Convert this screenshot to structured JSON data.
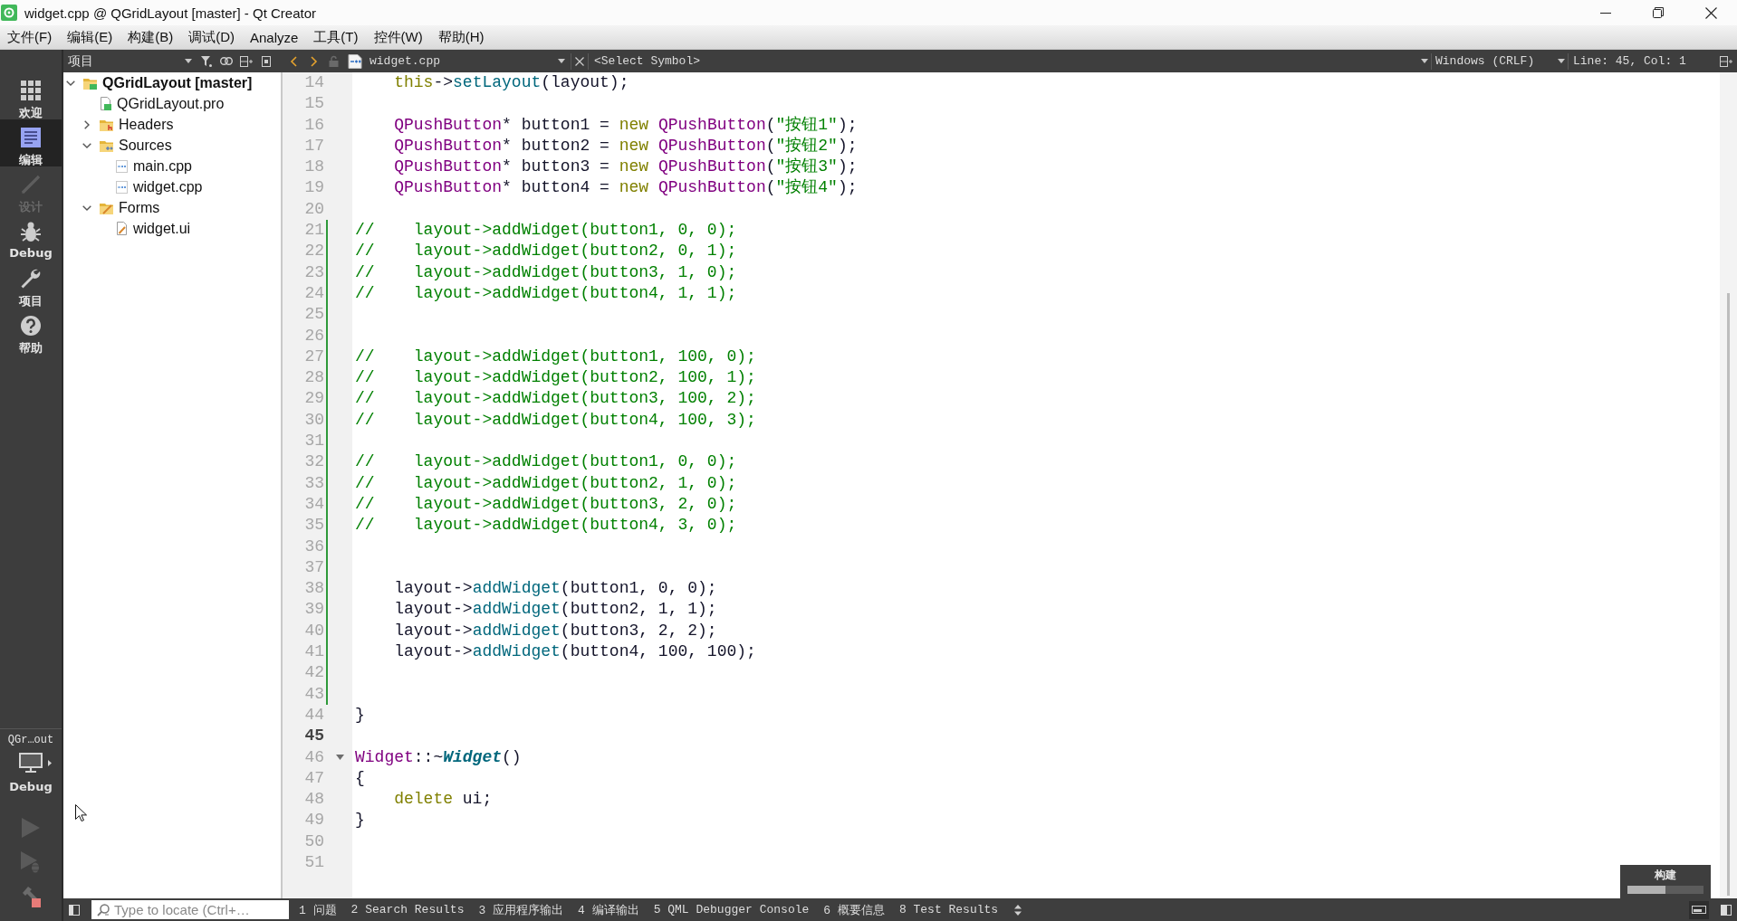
{
  "window": {
    "title": "widget.cpp @ QGridLayout [master] - Qt Creator"
  },
  "menu": [
    "文件(F)",
    "编辑(E)",
    "构建(B)",
    "调试(D)",
    "Analyze",
    "工具(T)",
    "控件(W)",
    "帮助(H)"
  ],
  "modes": [
    {
      "label": "欢迎",
      "kind": "welcome",
      "selected": false,
      "disabled": false
    },
    {
      "label": "编辑",
      "kind": "edit",
      "selected": true,
      "disabled": false
    },
    {
      "label": "设计",
      "kind": "design",
      "selected": false,
      "disabled": true
    },
    {
      "label": "Debug",
      "kind": "debug",
      "selected": false,
      "disabled": false
    },
    {
      "label": "项目",
      "kind": "projects",
      "selected": false,
      "disabled": false
    },
    {
      "label": "帮助",
      "kind": "help",
      "selected": false,
      "disabled": false
    }
  ],
  "kit": {
    "project": "QGr…out",
    "config": "Debug"
  },
  "run_buttons": [
    {
      "kind": "run",
      "disabled": true
    },
    {
      "kind": "debug",
      "disabled": true
    },
    {
      "kind": "stop-build",
      "disabled": false
    }
  ],
  "project_pane": {
    "view": "项目",
    "tree": [
      {
        "label": "QGridLayout [master]",
        "kind": "project",
        "expanded": true,
        "children": [
          {
            "label": "QGridLayout.pro",
            "kind": "pro-file"
          },
          {
            "label": "Headers",
            "kind": "header-folder",
            "expanded": false
          },
          {
            "label": "Sources",
            "kind": "source-folder",
            "expanded": true,
            "children": [
              {
                "label": "main.cpp",
                "kind": "cpp-file"
              },
              {
                "label": "widget.cpp",
                "kind": "cpp-file"
              }
            ]
          },
          {
            "label": "Forms",
            "kind": "form-folder",
            "expanded": true,
            "children": [
              {
                "label": "widget.ui",
                "kind": "ui-file"
              }
            ]
          }
        ]
      }
    ]
  },
  "editor": {
    "file": "widget.cpp",
    "symbol": "<Select Symbol>",
    "line_ending": "Windows (CRLF)",
    "cursor": "Line: 45, Col: 1",
    "lines": [
      {
        "number": "14",
        "indented": true,
        "tokens": [
          {
            "kind": "keyword",
            "text": "this"
          },
          {
            "kind": "plain",
            "text": "->"
          },
          {
            "kind": "function",
            "text": "setLayout"
          },
          {
            "kind": "plain",
            "text": "(layout);"
          }
        ],
        "changed": false,
        "current": false,
        "fold": false
      },
      {
        "number": "15",
        "changed": false,
        "current": false,
        "fold": false
      },
      {
        "number": "16",
        "indented": true,
        "tokens": [
          {
            "kind": "type",
            "text": "QPushButton"
          },
          {
            "kind": "plain",
            "text": "* button1 = "
          },
          {
            "kind": "keyword",
            "text": "new "
          },
          {
            "kind": "type",
            "text": "QPushButton"
          },
          {
            "kind": "plain",
            "text": "("
          },
          {
            "kind": "string",
            "text": "\"按钮1\""
          },
          {
            "kind": "plain",
            "text": ");"
          }
        ],
        "changed": false,
        "current": false,
        "fold": false
      },
      {
        "number": "17",
        "indented": true,
        "tokens": [
          {
            "kind": "type",
            "text": "QPushButton"
          },
          {
            "kind": "plain",
            "text": "* button2 = "
          },
          {
            "kind": "keyword",
            "text": "new "
          },
          {
            "kind": "type",
            "text": "QPushButton"
          },
          {
            "kind": "plain",
            "text": "("
          },
          {
            "kind": "string",
            "text": "\"按钮2\""
          },
          {
            "kind": "plain",
            "text": ");"
          }
        ],
        "changed": false,
        "current": false,
        "fold": false
      },
      {
        "number": "18",
        "indented": true,
        "tokens": [
          {
            "kind": "type",
            "text": "QPushButton"
          },
          {
            "kind": "plain",
            "text": "* button3 = "
          },
          {
            "kind": "keyword",
            "text": "new "
          },
          {
            "kind": "type",
            "text": "QPushButton"
          },
          {
            "kind": "plain",
            "text": "("
          },
          {
            "kind": "string",
            "text": "\"按钮3\""
          },
          {
            "kind": "plain",
            "text": ");"
          }
        ],
        "changed": false,
        "current": false,
        "fold": false
      },
      {
        "number": "19",
        "indented": true,
        "tokens": [
          {
            "kind": "type",
            "text": "QPushButton"
          },
          {
            "kind": "plain",
            "text": "* button4 = "
          },
          {
            "kind": "keyword",
            "text": "new "
          },
          {
            "kind": "type",
            "text": "QPushButton"
          },
          {
            "kind": "plain",
            "text": "("
          },
          {
            "kind": "string",
            "text": "\"按钮4\""
          },
          {
            "kind": "plain",
            "text": ");"
          }
        ],
        "changed": false,
        "current": false,
        "fold": false
      },
      {
        "number": "20",
        "changed": false,
        "current": false,
        "fold": false
      },
      {
        "number": "21",
        "indented": false,
        "tokens": [
          {
            "kind": "comment",
            "text": "//    layout->addWidget(button1, 0, 0);"
          }
        ],
        "changed": true,
        "current": false,
        "fold": false
      },
      {
        "number": "22",
        "indented": false,
        "tokens": [
          {
            "kind": "comment",
            "text": "//    layout->addWidget(button2, 0, 1);"
          }
        ],
        "changed": true,
        "current": false,
        "fold": false
      },
      {
        "number": "23",
        "indented": false,
        "tokens": [
          {
            "kind": "comment",
            "text": "//    layout->addWidget(button3, 1, 0);"
          }
        ],
        "changed": true,
        "current": false,
        "fold": false
      },
      {
        "number": "24",
        "indented": false,
        "tokens": [
          {
            "kind": "comment",
            "text": "//    layout->addWidget(button4, 1, 1);"
          }
        ],
        "changed": true,
        "current": false,
        "fold": false
      },
      {
        "number": "25",
        "changed": true,
        "current": false,
        "fold": false
      },
      {
        "number": "26",
        "changed": true,
        "current": false,
        "fold": false
      },
      {
        "number": "27",
        "indented": false,
        "tokens": [
          {
            "kind": "comment",
            "text": "//    layout->addWidget(button1, 100, 0);"
          }
        ],
        "changed": true,
        "current": false,
        "fold": false
      },
      {
        "number": "28",
        "indented": false,
        "tokens": [
          {
            "kind": "comment",
            "text": "//    layout->addWidget(button2, 100, 1);"
          }
        ],
        "changed": true,
        "current": false,
        "fold": false
      },
      {
        "number": "29",
        "indented": false,
        "tokens": [
          {
            "kind": "comment",
            "text": "//    layout->addWidget(button3, 100, 2);"
          }
        ],
        "changed": true,
        "current": false,
        "fold": false
      },
      {
        "number": "30",
        "indented": false,
        "tokens": [
          {
            "kind": "comment",
            "text": "//    layout->addWidget(button4, 100, 3);"
          }
        ],
        "changed": true,
        "current": false,
        "fold": false
      },
      {
        "number": "31",
        "changed": true,
        "current": false,
        "fold": false
      },
      {
        "number": "32",
        "indented": false,
        "tokens": [
          {
            "kind": "comment",
            "text": "//    layout->addWidget(button1, 0, 0);"
          }
        ],
        "changed": true,
        "current": false,
        "fold": false
      },
      {
        "number": "33",
        "indented": false,
        "tokens": [
          {
            "kind": "comment",
            "text": "//    layout->addWidget(button2, 1, 0);"
          }
        ],
        "changed": true,
        "current": false,
        "fold": false
      },
      {
        "number": "34",
        "indented": false,
        "tokens": [
          {
            "kind": "comment",
            "text": "//    layout->addWidget(button3, 2, 0);"
          }
        ],
        "changed": true,
        "current": false,
        "fold": false
      },
      {
        "number": "35",
        "indented": false,
        "tokens": [
          {
            "kind": "comment",
            "text": "//    layout->addWidget(button4, 3, 0);"
          }
        ],
        "changed": true,
        "current": false,
        "fold": false
      },
      {
        "number": "36",
        "changed": true,
        "current": false,
        "fold": false
      },
      {
        "number": "37",
        "changed": true,
        "current": false,
        "fold": false
      },
      {
        "number": "38",
        "indented": true,
        "tokens": [
          {
            "kind": "plain",
            "text": "layout->"
          },
          {
            "kind": "function",
            "text": "addWidget"
          },
          {
            "kind": "plain",
            "text": "(button1, 0, 0);"
          }
        ],
        "changed": true,
        "current": false,
        "fold": false
      },
      {
        "number": "39",
        "indented": true,
        "tokens": [
          {
            "kind": "plain",
            "text": "layout->"
          },
          {
            "kind": "function",
            "text": "addWidget"
          },
          {
            "kind": "plain",
            "text": "(button2, 1, 1);"
          }
        ],
        "changed": true,
        "current": false,
        "fold": false
      },
      {
        "number": "40",
        "indented": true,
        "tokens": [
          {
            "kind": "plain",
            "text": "layout->"
          },
          {
            "kind": "function",
            "text": "addWidget"
          },
          {
            "kind": "plain",
            "text": "(button3, 2, 2);"
          }
        ],
        "changed": true,
        "current": false,
        "fold": false
      },
      {
        "number": "41",
        "indented": true,
        "tokens": [
          {
            "kind": "plain",
            "text": "layout->"
          },
          {
            "kind": "function",
            "text": "addWidget"
          },
          {
            "kind": "plain",
            "text": "(button4, 100, 100);"
          }
        ],
        "changed": true,
        "current": false,
        "fold": false
      },
      {
        "number": "42",
        "changed": true,
        "current": false,
        "fold": false
      },
      {
        "number": "43",
        "changed": true,
        "current": false,
        "fold": false
      },
      {
        "number": "44",
        "indented": false,
        "tokens": [
          {
            "kind": "plain",
            "text": "}"
          }
        ],
        "changed": false,
        "current": false,
        "fold": false
      },
      {
        "number": "45",
        "changed": false,
        "current": true,
        "fold": false
      },
      {
        "number": "46",
        "indented": false,
        "tokens": [
          {
            "kind": "type",
            "text": "Widget"
          },
          {
            "kind": "plain",
            "text": "::~"
          },
          {
            "kind": "declaration",
            "text": "Widget"
          },
          {
            "kind": "plain",
            "text": "()"
          }
        ],
        "changed": false,
        "current": false,
        "fold": true
      },
      {
        "number": "47",
        "indented": false,
        "tokens": [
          {
            "kind": "plain",
            "text": "{"
          }
        ],
        "changed": false,
        "current": false,
        "fold": false
      },
      {
        "number": "48",
        "indented": true,
        "tokens": [
          {
            "kind": "keyword",
            "text": "delete"
          },
          {
            "kind": "plain",
            "text": " ui;"
          }
        ],
        "changed": false,
        "current": false,
        "fold": false
      },
      {
        "number": "49",
        "indented": false,
        "tokens": [
          {
            "kind": "plain",
            "text": "}"
          }
        ],
        "changed": false,
        "current": false,
        "fold": false
      },
      {
        "number": "50",
        "changed": false,
        "current": false,
        "fold": false
      },
      {
        "number": "51",
        "changed": false,
        "current": false,
        "fold": false
      }
    ]
  },
  "build_progress": {
    "label": "构建",
    "level": 0.5
  },
  "status_bar": {
    "locate_placeholder": "Type to locate (Ctrl+…",
    "panes": [
      {
        "label": "1 问题",
        "selected": false
      },
      {
        "label": "2 Search Results",
        "selected": false
      },
      {
        "label": "3 应用程序输出",
        "selected": false
      },
      {
        "label": "4 编译输出",
        "selected": false
      },
      {
        "label": "5 QML Debugger Console",
        "selected": false
      },
      {
        "label": "6 概要信息",
        "selected": false
      },
      {
        "label": "8 Test Results",
        "selected": false
      }
    ]
  }
}
